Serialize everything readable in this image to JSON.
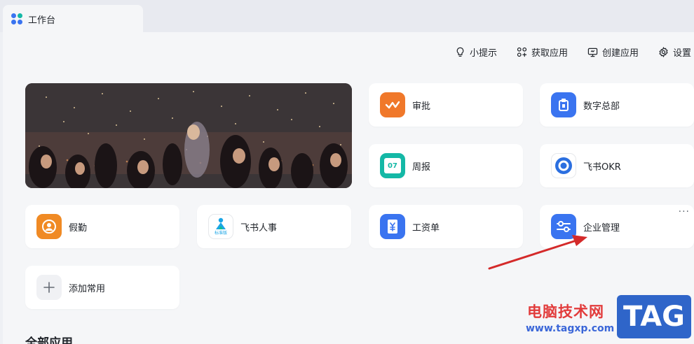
{
  "window": {
    "tab_title": "工作台"
  },
  "toolbar": {
    "tips": "小提示",
    "get_apps": "获取应用",
    "create_app": "创建应用",
    "settings": "设置"
  },
  "apps": {
    "approval": "审批",
    "digital_hq": "数字总部",
    "weekly": "周报",
    "weekly_icon_number": "07",
    "okr": "飞书OKR",
    "leave": "假勤",
    "hr": "飞书人事",
    "hr_badge": "标准版",
    "payroll": "工资单",
    "enterprise": "企业管理",
    "add_common": "添加常用"
  },
  "section": {
    "all_apps": "全部应用"
  },
  "watermark": {
    "site_name": "电脑技术网",
    "url": "www.tagxp.com",
    "logo": "TAG"
  },
  "colors": {
    "approval": "#f0782a",
    "digital_hq": "#3a74f0",
    "weekly": "#14b8a6",
    "okr": "#2b6fe0",
    "leave": "#f08a24",
    "hr": "#1aa5e6",
    "payroll": "#3a74f0",
    "enterprise": "#3a74f0",
    "arrow": "#d42a2a"
  }
}
